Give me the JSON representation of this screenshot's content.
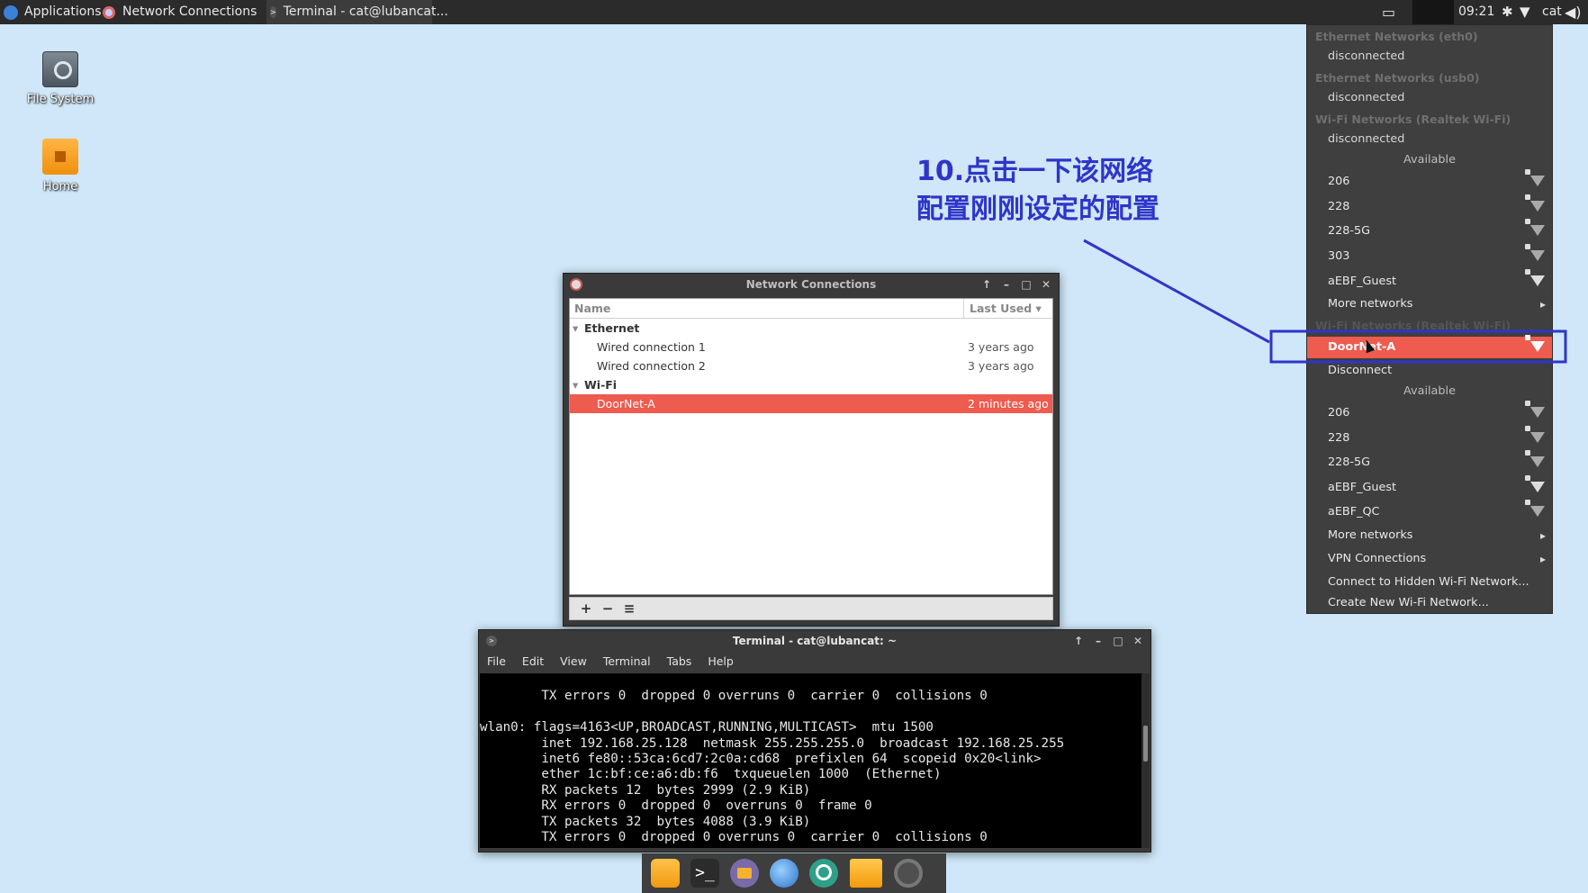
{
  "top_panel": {
    "applications": "Applications",
    "task_network": "Network Connections",
    "task_terminal": "Terminal - cat@lubancat...",
    "clock": "09:21",
    "user": "cat",
    "screen_icon": "display-icon",
    "bluetooth_icon": "bluetooth-icon",
    "wifi_icon": "wifi-icon",
    "volume_icon": "volume-icon"
  },
  "desktop": {
    "file_system": "File System",
    "home": "Home"
  },
  "annotation": {
    "line1": "10.点击一下该网络",
    "line2": "配置刚刚设定的配置",
    "color": "#2f35c9"
  },
  "network_connections": {
    "title": "Network Connections",
    "col_name": "Name",
    "col_last_used": "Last Used ▾",
    "groups": [
      {
        "label": "Ethernet"
      },
      {
        "label": "Wi-Fi"
      }
    ],
    "rows": [
      {
        "name": "Wired connection 1",
        "last_used": "3 years ago"
      },
      {
        "name": "Wired connection 2",
        "last_used": "3 years ago"
      },
      {
        "name": "DoorNet-A",
        "last_used": "2 minutes ago"
      }
    ],
    "toolbar": {
      "add": "+",
      "remove": "−",
      "settings": "≡"
    }
  },
  "terminal": {
    "title": "Terminal - cat@lubancat: ~",
    "menu": [
      "File",
      "Edit",
      "View",
      "Terminal",
      "Tabs",
      "Help"
    ],
    "lines": [
      "        TX errors 0  dropped 0 overruns 0  carrier 0  collisions 0",
      "",
      "wlan0: flags=4163<UP,BROADCAST,RUNNING,MULTICAST>  mtu 1500",
      "        inet 192.168.25.128  netmask 255.255.255.0  broadcast 192.168.25.255",
      "        inet6 fe80::53ca:6cd7:2c0a:cd68  prefixlen 64  scopeid 0x20<link>",
      "        ether 1c:bf:ce:a6:db:f6  txqueuelen 1000  (Ethernet)",
      "        RX packets 12  bytes 2999 (2.9 KiB)",
      "        RX errors 0  dropped 0  overruns 0  frame 0",
      "        TX packets 32  bytes 4088 (3.9 KiB)",
      "        TX errors 0  dropped 0 overruns 0  carrier 0  collisions 0"
    ]
  },
  "network_menu": {
    "eth0_head": "Ethernet Networks (eth0)",
    "eth0_status": "disconnected",
    "usb0_head": "Ethernet Networks (usb0)",
    "usb0_status": "disconnected",
    "wifi1_head": "Wi-Fi Networks (Realtek Wi-Fi)",
    "wifi1_status": "disconnected",
    "available1": "Available",
    "list1": [
      "206",
      "228",
      "228-5G",
      "303",
      "aEBF_Guest"
    ],
    "more1": "More networks",
    "wifi2_head": "Wi-Fi Networks (Realtek Wi-Fi)",
    "connected": "DoorNet-A",
    "disconnect": "Disconnect",
    "available2": "Available",
    "list2": [
      "206",
      "228",
      "228-5G",
      "aEBF_Guest",
      "aEBF_QC"
    ],
    "more2": "More networks",
    "vpn": "VPN Connections",
    "hidden": "Connect to Hidden Wi-Fi Network...",
    "create": "Create New Wi-Fi Network...",
    "highlight_color": "#ee5b4f",
    "box_color": "#2f35c9"
  },
  "dock": {
    "items": [
      "files-icon",
      "terminal-icon",
      "file-manager-icon",
      "web-browser-icon",
      "search-icon",
      "folder-icon",
      "camera-icon"
    ]
  }
}
